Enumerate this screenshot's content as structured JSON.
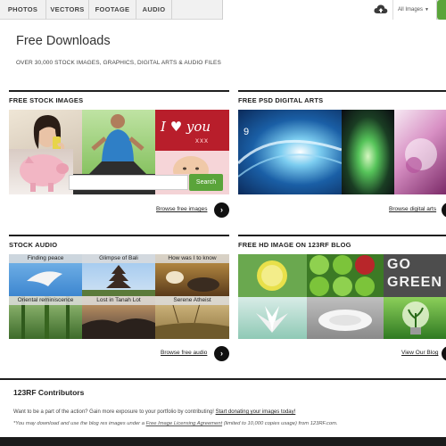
{
  "nav": {
    "tabs": [
      "PHOTOS",
      "VECTORS",
      "FOOTAGE",
      "AUDIO"
    ],
    "image_type": "All Images",
    "icons": {
      "cloud": "cloud-upload-icon",
      "caret": "caret-down-icon"
    }
  },
  "page": {
    "title": "Free Downloads",
    "subtitle": "OVER 30,000 STOCK IMAGES, GRAPHICS, DIGITAL ARTS & AUDIO FILES"
  },
  "stock": {
    "heading": "FREE STOCK IMAGES",
    "search_button": "Search",
    "search_value": "",
    "love_text": "I ♥ you",
    "browse": "Browse free images",
    "arrow": "›"
  },
  "psd": {
    "heading": "FREE PSD DIGITAL ARTS",
    "browse": "Browse digital arts",
    "arrow": "›"
  },
  "audio": {
    "heading": "STOCK AUDIO",
    "labels": [
      "Finding peace",
      "Glimpse of Bali",
      "How was I to know",
      "Oriental reminiscence",
      "Lost in Tanah Lot",
      "Serene Atheist"
    ],
    "browse": "Browse free audio",
    "arrow": "›"
  },
  "blog": {
    "heading": "FREE HD IMAGE ON 123RF BLOG",
    "go_green": "GO GREEN",
    "browse": "View Our Blog",
    "arrow": "›"
  },
  "contributors": {
    "title": "123RF Contributors",
    "text": "Want to be a part of the action? Gain more exposure to your portfolio by contributing!",
    "link": "Start donating your images today!",
    "note_prefix": "*You may download and use the blog res images under a",
    "note_link": "Free Image Licensing Agreement",
    "note_suffix": "(limited to 10,000 copies usage) from 123RF.com."
  },
  "colors": {
    "accent_green": "#5aa43a",
    "rule_black": "#1f1f1f",
    "nav_bg": "#f1f1f1"
  }
}
